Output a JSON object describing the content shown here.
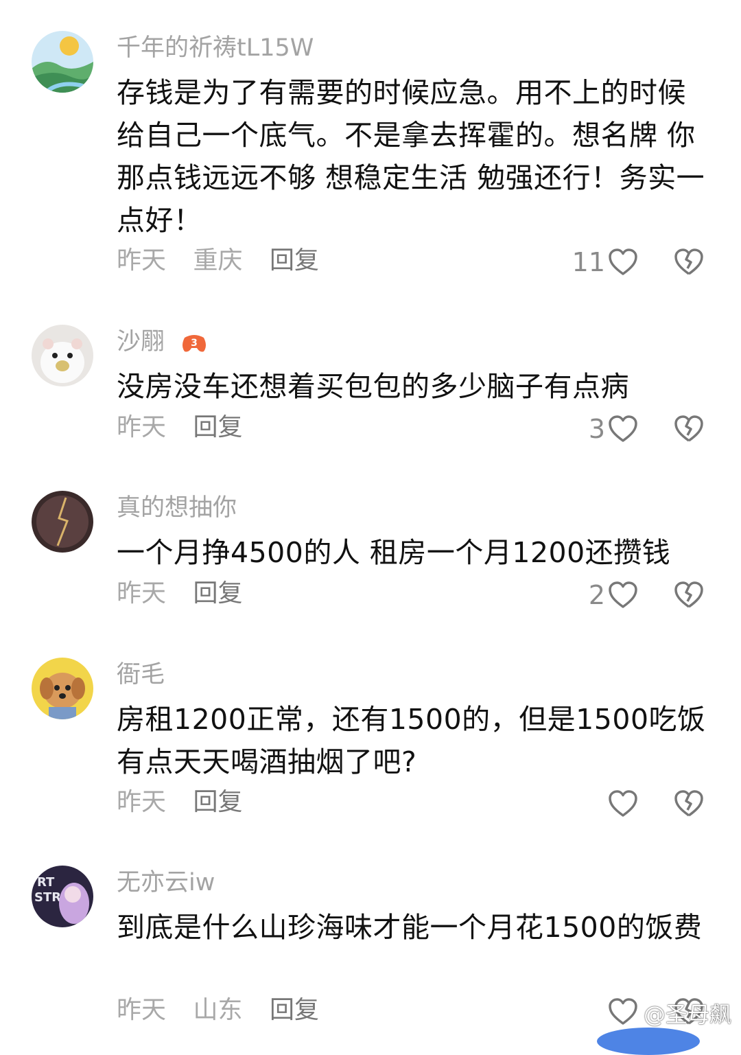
{
  "comments": [
    {
      "username": "千年的祈祷tL15W",
      "text": "存钱是为了有需要的时候应急。用不上的时候给自己一个底气。不是拿去挥霍的。想名牌 你那点钱远远不够 想稳定生活 勉强还行！务实一点好！",
      "time": "昨天",
      "location": "重庆",
      "reply_label": "回复",
      "likes": "11",
      "avatar": "landscape-avatar"
    },
    {
      "username": "沙翢",
      "badge": "3",
      "text": "没房没车还想着买包包的多少脑子有点病",
      "time": "昨天",
      "location": "",
      "reply_label": "回复",
      "likes": "3",
      "avatar": "hamster-avatar"
    },
    {
      "username": "真的想抽你",
      "text": "一个月挣4500的人 租房一个月1200还攒钱",
      "time": "昨天",
      "location": "",
      "reply_label": "回复",
      "likes": "2",
      "avatar": "dark-lightning-avatar"
    },
    {
      "username": "衙毛",
      "text": "房租1200正常，还有1500的，但是1500吃饭有点天天喝酒抽烟了吧?",
      "time": "昨天",
      "location": "",
      "reply_label": "回复",
      "likes": "",
      "avatar": "dog-avatar"
    },
    {
      "username": "无亦云iw",
      "text": "到底是什么山珍海味才能一个月花1500的饭费",
      "time": "昨天",
      "location": "山东",
      "reply_label": "回复",
      "likes": "",
      "avatar": "anime-avatar"
    }
  ],
  "watermark": "@圣母飙",
  "colors": {
    "meta": "#a8a8a8",
    "text": "#111111",
    "icon": "#777777"
  }
}
